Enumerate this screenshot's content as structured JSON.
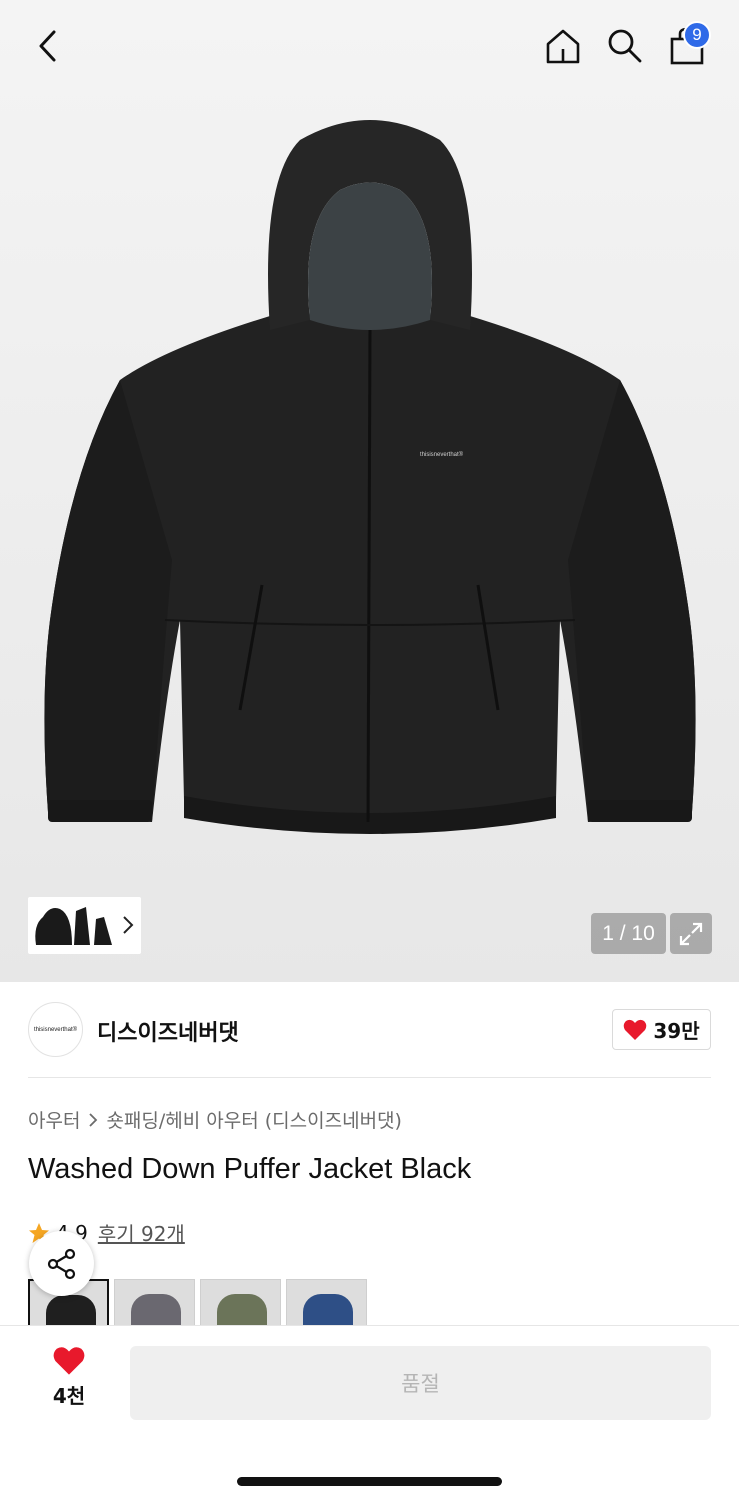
{
  "header": {
    "back_icon": "chevron-left-icon",
    "home_icon": "home-icon",
    "search_icon": "search-icon",
    "cart_icon": "shopping-bag-icon",
    "cart_count": "9",
    "badge_color": "#2f6ae8"
  },
  "gallery": {
    "counter": "1 / 10",
    "expand_icon": "expand-icon",
    "thumb_more_icon": "chevron-right-icon",
    "logo_text": "thisisneverthat®"
  },
  "brand": {
    "logo_text": "thisisneverthat®",
    "name": "디스이즈네버댓",
    "likes": "39만",
    "heart_color": "#e8192c"
  },
  "breadcrumb": {
    "category": "아우터",
    "separator_icon": "chevron-right-icon",
    "subcategory": "숏패딩/헤비 아우터 (디스이즈네버댓)"
  },
  "product": {
    "title": "Washed Down Puffer Jacket Black",
    "rating": "4.9",
    "reviews": "후기 92개",
    "star_color": "#f5a623"
  },
  "swatches": [
    {
      "name": "black",
      "color": "#1f1f1f"
    },
    {
      "name": "grey",
      "color": "#6a6870"
    },
    {
      "name": "olive",
      "color": "#6b7459"
    },
    {
      "name": "blue",
      "color": "#2e4f86"
    }
  ],
  "bottom": {
    "wish_count": "4천",
    "buy_label": "품절",
    "share_icon": "share-icon"
  }
}
